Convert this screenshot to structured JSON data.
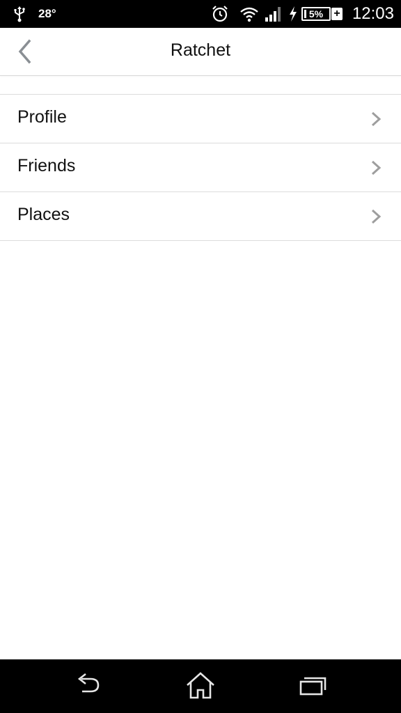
{
  "status_bar": {
    "temperature": "28°",
    "battery_text": "5%",
    "battery_level_percent": 5,
    "charging_plus": "+",
    "time": "12:03",
    "icons": [
      "usb-icon",
      "alarm-icon",
      "wifi-icon",
      "signal-icon",
      "charging-bolt-icon",
      "battery-icon"
    ]
  },
  "nav": {
    "title": "Ratchet",
    "back_icon": "chevron-left-icon"
  },
  "list": {
    "items": [
      {
        "label": "Profile",
        "icon": "chevron-right-icon"
      },
      {
        "label": "Friends",
        "icon": "chevron-right-icon"
      },
      {
        "label": "Places",
        "icon": "chevron-right-icon"
      }
    ]
  },
  "system_nav": {
    "buttons": [
      "back-icon",
      "home-icon",
      "recent-apps-icon"
    ]
  },
  "colors": {
    "status_bar_bg": "#000000",
    "background": "#ffffff",
    "separator": "#dcdcdc",
    "chevron": "#9e9e9e",
    "text": "#111111"
  }
}
